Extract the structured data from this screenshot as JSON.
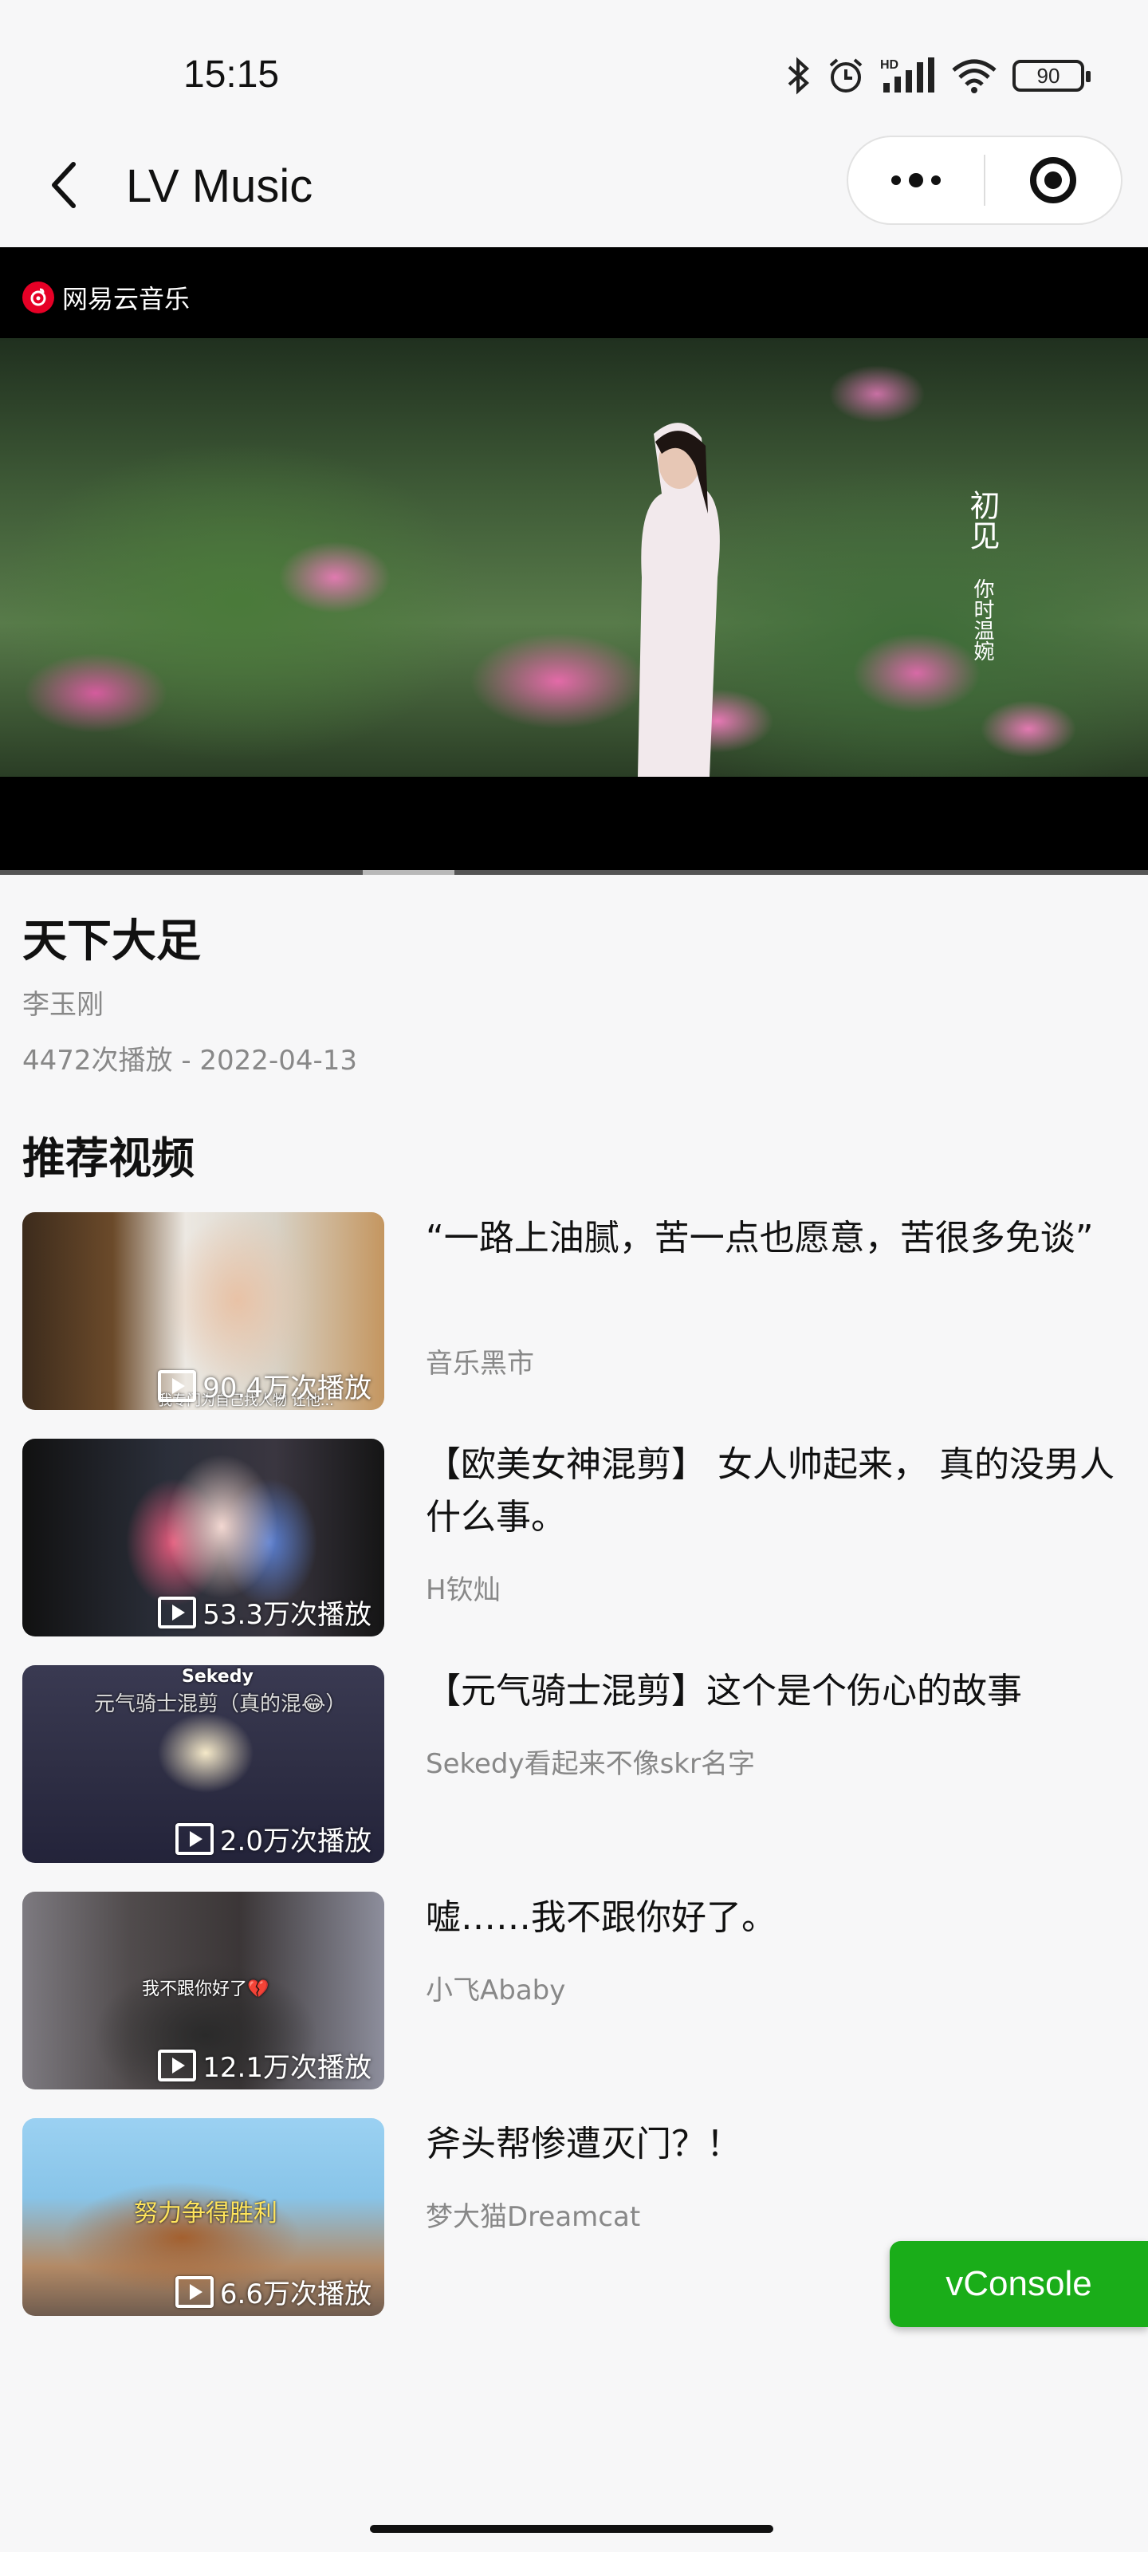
{
  "status_bar": {
    "time": "15:15",
    "battery": "90"
  },
  "nav": {
    "title": "LV Music"
  },
  "video": {
    "logo_text": "网易云音乐",
    "caption_main": "初见",
    "caption_sub": "你时温婉",
    "progress": 0.08
  },
  "song": {
    "title": "天下大足",
    "artist": "李玉刚",
    "meta": "4472次播放 - 2022-04-13"
  },
  "recommend": {
    "section_title": "推荐视频",
    "items": [
      {
        "title": "“一路上油腻，苦一点也愿意，苦很多免谈”",
        "author": "音乐黑市",
        "plays": "90.4万次播放",
        "overlay": "我专门为自己找人物 让他..."
      },
      {
        "title": "【欧美女神混剪】 女人帅起来， 真的没男人什么事。",
        "author": "H钦灿",
        "plays": "53.3万次播放",
        "overlay": ""
      },
      {
        "title": "【元气骑士混剪】这个是个伤心的故事",
        "author": "Sekedy看起来不像skr名字",
        "plays": "2.0万次播放",
        "overlay": "元气骑士混剪（真的混😂）",
        "overlay_name": "Sekedy"
      },
      {
        "title": "嘘……我不跟你好了。",
        "author": "小飞Ababy",
        "plays": "12.1万次播放",
        "overlay": "我不跟你好了💔"
      },
      {
        "title": "斧头帮惨遭灭门？！",
        "author": "梦大猫Dreamcat",
        "plays": "6.6万次播放",
        "overlay": "努力争得胜利"
      }
    ]
  },
  "vconsole": {
    "label": "vConsole"
  },
  "colors": {
    "vconsole_bg": "#1aad19",
    "netease_red": "#e60026"
  }
}
